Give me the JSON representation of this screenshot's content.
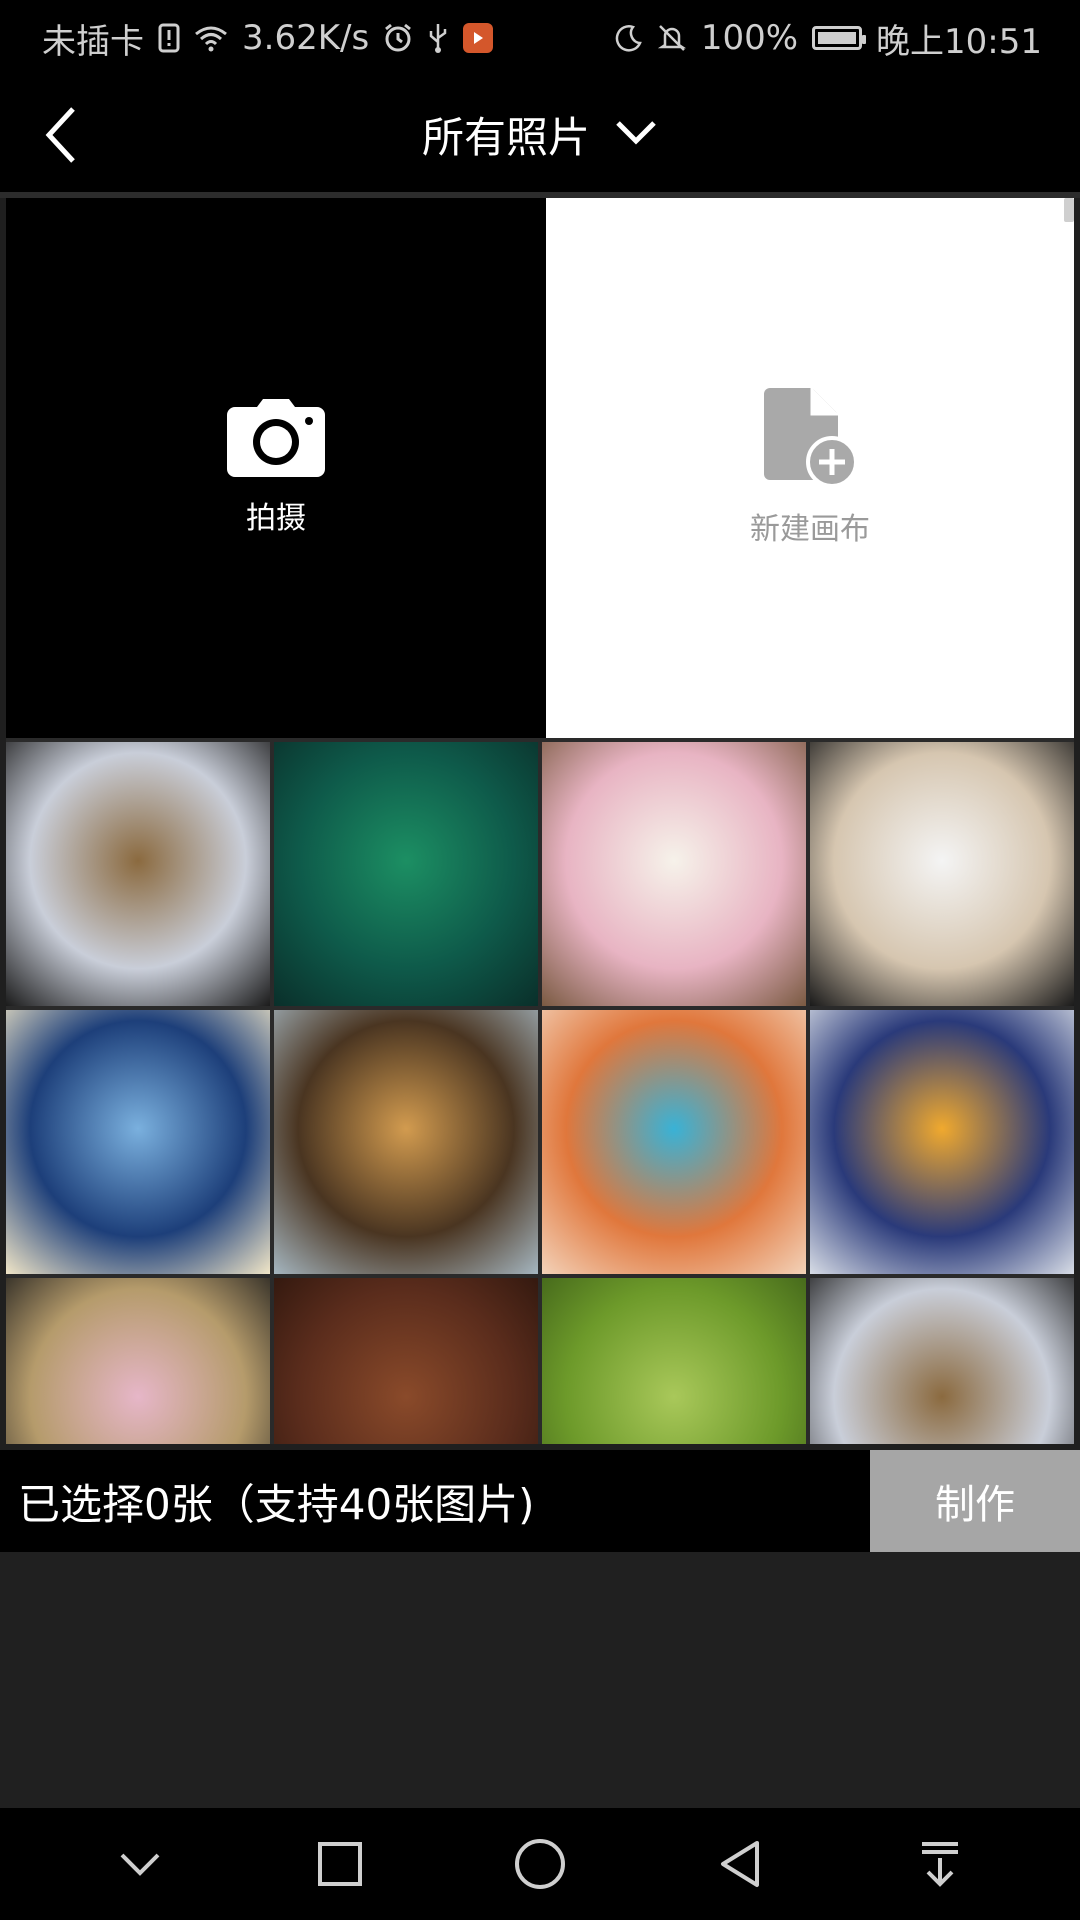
{
  "status_bar": {
    "carrier": "未插卡",
    "speed": "3.62K/s",
    "battery": "100%",
    "time": "晚上10:51",
    "icons": [
      "sim-alert-icon",
      "wifi-icon",
      "alarm-icon",
      "usb-icon",
      "video-app-icon",
      "moon-icon",
      "mute-icon",
      "battery-icon"
    ]
  },
  "header": {
    "title": "所有照片",
    "back_icon": "back-arrow-icon",
    "dropdown_icon": "chevron-down-icon"
  },
  "grid": {
    "camera_tile": {
      "label": "拍摄",
      "icon": "camera-icon"
    },
    "canvas_tile": {
      "label": "新建画布",
      "icon": "new-document-icon"
    },
    "photos": [
      {
        "name": "spiral-staircase-photo",
        "colors": [
          "#c9ced9",
          "#8b6a3f",
          "#1b1b1b"
        ]
      },
      {
        "name": "bamboo-forest-photo",
        "colors": [
          "#0e5a4a",
          "#1c8f63",
          "#0a2f2a"
        ]
      },
      {
        "name": "pink-roses-photo",
        "colors": [
          "#e8b4c3",
          "#f6f2ea",
          "#7a5a42"
        ]
      },
      {
        "name": "fashion-model-white-shirt-photo",
        "colors": [
          "#d6c6b0",
          "#f4f4f4",
          "#1a1a1a"
        ]
      },
      {
        "name": "ice-cave-photo",
        "colors": [
          "#1d3f7a",
          "#7ab0de",
          "#f1e6c7"
        ]
      },
      {
        "name": "highway-interchange-photo",
        "colors": [
          "#4a3521",
          "#d29b4f",
          "#a5b6c0"
        ]
      },
      {
        "name": "autumn-forest-river-photo",
        "colors": [
          "#e0773c",
          "#39b2d6",
          "#f3d2b9"
        ]
      },
      {
        "name": "golden-mountain-photo",
        "colors": [
          "#2a3a7a",
          "#f0a92e",
          "#d8dde6"
        ]
      },
      {
        "name": "woman-evening-gown-photo",
        "colors": [
          "#b59b6b",
          "#e6b6c8",
          "#1a1a1a"
        ]
      },
      {
        "name": "violin-silk-photo",
        "colors": [
          "#5a2c1c",
          "#8a4a2a",
          "#2a140c"
        ]
      },
      {
        "name": "wheat-field-photo",
        "colors": [
          "#6d9a2a",
          "#a9c85a",
          "#3d5e18"
        ]
      },
      {
        "name": "spiral-staircase-photo-2",
        "colors": [
          "#c9ced9",
          "#8b6a3f",
          "#1b1b1b"
        ]
      }
    ]
  },
  "bottom": {
    "selected_text": "已选择0张（支持40张图片)",
    "make_button": "制作"
  },
  "nav_bar": {
    "icons": [
      "hide-nav-icon",
      "recents-icon",
      "home-icon",
      "back-icon",
      "notification-pull-icon"
    ]
  },
  "colors": {
    "background": "#1f1f1f",
    "bar": "#000000",
    "button_disabled": "#a6a6a6",
    "canvas_icon": "#a9a9a9"
  }
}
